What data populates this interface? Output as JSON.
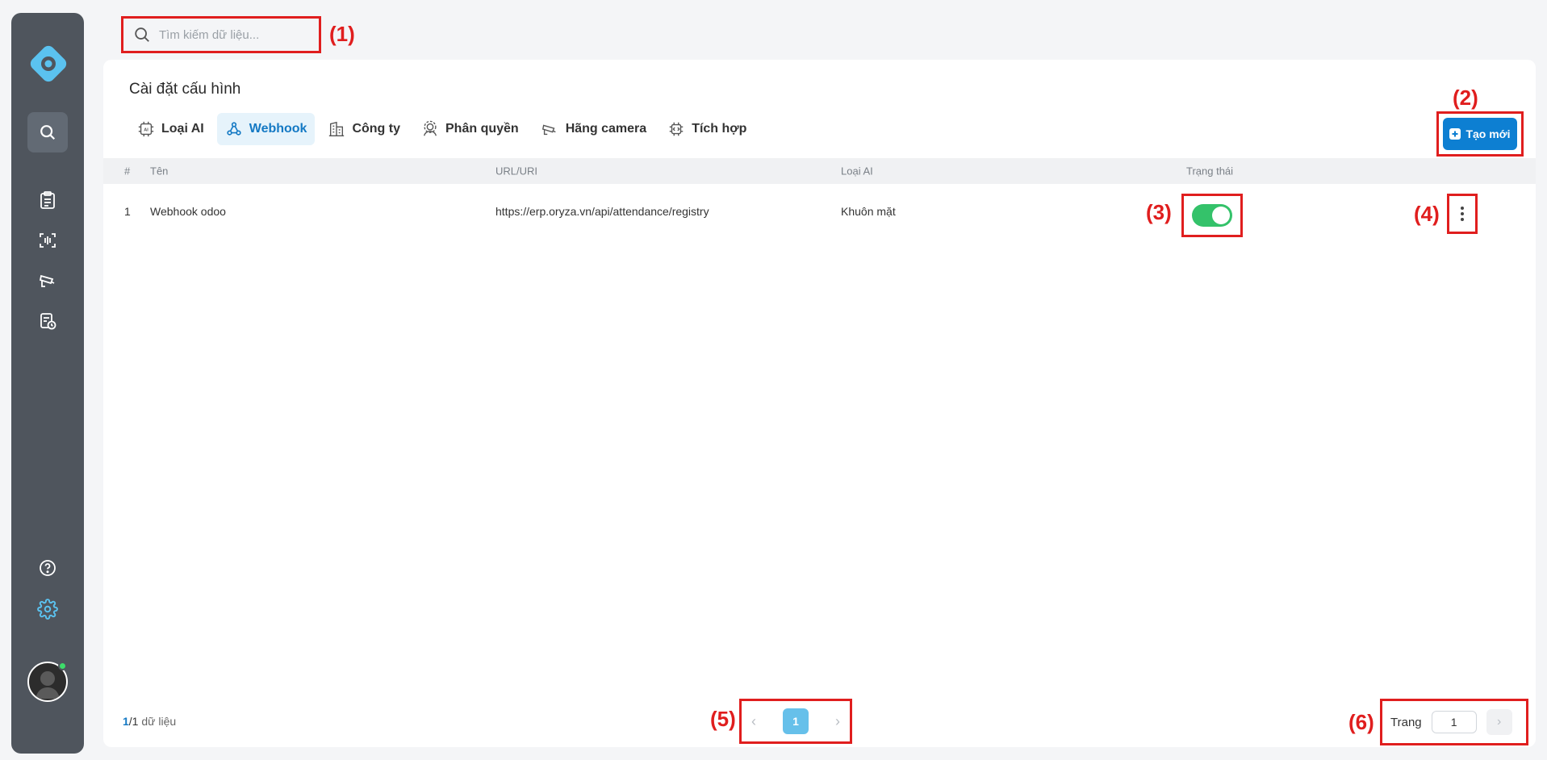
{
  "search": {
    "placeholder": "Tìm kiếm dữ liệu..."
  },
  "page": {
    "title": "Cài đặt cấu hình"
  },
  "tabs": [
    {
      "label": "Loại AI",
      "icon": "ai-chip-icon"
    },
    {
      "label": "Webhook",
      "icon": "webhook-icon",
      "active": true
    },
    {
      "label": "Công ty",
      "icon": "building-icon"
    },
    {
      "label": "Phân quyền",
      "icon": "users-gear-icon"
    },
    {
      "label": "Hãng camera",
      "icon": "cctv-camera-icon"
    },
    {
      "label": "Tích hợp",
      "icon": "integration-chip-icon"
    }
  ],
  "toolbar": {
    "create_label": "Tạo mới"
  },
  "table": {
    "columns": [
      "#",
      "Tên",
      "URL/URI",
      "Loại AI",
      "Trạng thái"
    ],
    "rows": [
      {
        "index": "1",
        "name": "Webhook odoo",
        "url": "https://erp.oryza.vn/api/attendance/registry",
        "ai_type": "Khuôn mặt",
        "enabled": true
      }
    ]
  },
  "footer": {
    "count_current": "1",
    "count_total": "/1",
    "count_suffix": " dữ liệu",
    "current_page": "1",
    "goto_label": "Trang",
    "goto_value": "1"
  },
  "annotations": [
    "(1)",
    "(2)",
    "(3)",
    "(4)",
    "(5)",
    "(6)"
  ],
  "colors": {
    "accent": "#0d7fd2",
    "toggle_on": "#34c26a",
    "annotation": "#e01e1e",
    "sidebar": "#4f555d"
  }
}
